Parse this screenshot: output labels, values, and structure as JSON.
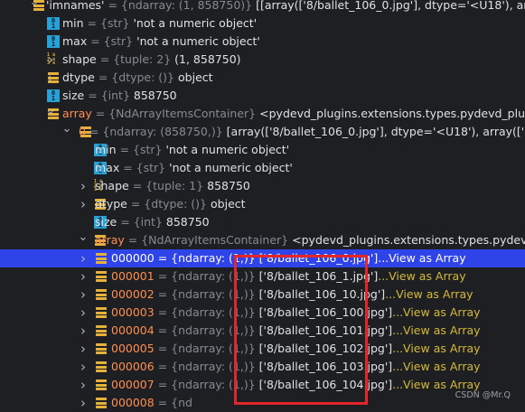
{
  "tree": {
    "rows": [
      {
        "level": 1,
        "arrow": "down",
        "icon": "bars",
        "name": "'imnames'",
        "name_color": "white",
        "type": "= {ndarray: (1, 858750)}",
        "value": "[[array(['8/ballet_106_0.jpg'], dtype='<U18'),  array(['8/bal",
        "value_style": "white",
        "selected": false
      },
      {
        "level": 2,
        "arrow": "none",
        "icon": "01",
        "name": "min",
        "name_color": "white",
        "type": "= {str}",
        "value": "'not a numeric object'",
        "value_style": "white",
        "selected": false
      },
      {
        "level": 2,
        "arrow": "none",
        "icon": "01",
        "name": "max",
        "name_color": "white",
        "type": "= {str}",
        "value": "'not a numeric object'",
        "value_style": "white",
        "selected": false
      },
      {
        "level": 2,
        "arrow": "right",
        "icon": "123",
        "name": "shape",
        "name_color": "white",
        "type": "= {tuple: 2}",
        "value": "(1, 858750)",
        "value_style": "white",
        "selected": false
      },
      {
        "level": 2,
        "arrow": "right",
        "icon": "bars",
        "name": "dtype",
        "name_color": "white",
        "type": "= {dtype: ()}",
        "value": "object",
        "value_style": "white",
        "selected": false
      },
      {
        "level": 2,
        "arrow": "none",
        "icon": "01",
        "name": "size",
        "name_color": "white",
        "type": "= {int}",
        "value": "858750",
        "value_style": "white",
        "selected": false
      },
      {
        "level": 2,
        "arrow": "down",
        "icon": "bars",
        "name": "array",
        "name_color": "orange",
        "type": "= {NdArrayItemsContainer}",
        "value": "<pydevd_plugins.extensions.types.pydevd_plugin_nump",
        "value_style": "white",
        "selected": false
      },
      {
        "level": 3,
        "arrow": "down",
        "icon": "bars",
        "name": "0",
        "name_color": "orange",
        "type": "= {ndarray: (858750,)}",
        "value": "[array(['8/ballet_106_0.jpg'], dtype='<U18'), array(['8/ballet_10",
        "value_style": "white",
        "selected": false
      },
      {
        "level": 4,
        "arrow": "none",
        "icon": "01",
        "name": "min",
        "name_color": "white",
        "type": "= {str}",
        "value": "'not a numeric object'",
        "value_style": "white",
        "selected": false
      },
      {
        "level": 4,
        "arrow": "none",
        "icon": "01",
        "name": "max",
        "name_color": "white",
        "type": "= {str}",
        "value": "'not a numeric object'",
        "value_style": "white",
        "selected": false
      },
      {
        "level": 4,
        "arrow": "right",
        "icon": "123",
        "name": "shape",
        "name_color": "white",
        "type": "= {tuple: 1}",
        "value": "858750",
        "value_style": "white",
        "selected": false
      },
      {
        "level": 4,
        "arrow": "right",
        "icon": "bars",
        "name": "dtype",
        "name_color": "white",
        "type": "= {dtype: ()}",
        "value": "object",
        "value_style": "white",
        "selected": false
      },
      {
        "level": 4,
        "arrow": "none",
        "icon": "01",
        "name": "size",
        "name_color": "white",
        "type": "= {int}",
        "value": "858750",
        "value_style": "white",
        "selected": false
      },
      {
        "level": 4,
        "arrow": "down",
        "icon": "bars",
        "name": "array",
        "name_color": "orange",
        "type": "= {NdArrayItemsContainer}",
        "value": "<pydevd_plugins.extensions.types.pydevd_plugin",
        "value_style": "white",
        "selected": false
      },
      {
        "level": 5,
        "arrow": "right",
        "icon": "bars",
        "name": "000000",
        "name_color": "orange",
        "type": "= {ndarray: (1,)}",
        "value": "['8/ballet_106_0.jpg']",
        "link": "...View as Array",
        "value_style": "white",
        "selected": true
      },
      {
        "level": 5,
        "arrow": "right",
        "icon": "bars",
        "name": "000001",
        "name_color": "orange",
        "type": "= {ndarray: (1,)}",
        "value": "['8/ballet_106_1.jpg']",
        "link": "...View as Array",
        "value_style": "white",
        "selected": false
      },
      {
        "level": 5,
        "arrow": "right",
        "icon": "bars",
        "name": "000002",
        "name_color": "orange",
        "type": "= {ndarray: (1,)}",
        "value": "['8/ballet_106_10.jpg']",
        "link": "...View as Array",
        "value_style": "white",
        "selected": false
      },
      {
        "level": 5,
        "arrow": "right",
        "icon": "bars",
        "name": "000003",
        "name_color": "orange",
        "type": "= {ndarray: (1,)}",
        "value": "['8/ballet_106_100.jpg']",
        "link": "...View as Array",
        "value_style": "white",
        "selected": false
      },
      {
        "level": 5,
        "arrow": "right",
        "icon": "bars",
        "name": "000004",
        "name_color": "orange",
        "type": "= {ndarray: (1,)}",
        "value": "['8/ballet_106_101.jpg']",
        "link": "...View as Array",
        "value_style": "white",
        "selected": false
      },
      {
        "level": 5,
        "arrow": "right",
        "icon": "bars",
        "name": "000005",
        "name_color": "orange",
        "type": "= {ndarray: (1,)}",
        "value": "['8/ballet_106_102.jpg']",
        "link": "...View as Array",
        "value_style": "white",
        "selected": false
      },
      {
        "level": 5,
        "arrow": "right",
        "icon": "bars",
        "name": "000006",
        "name_color": "orange",
        "type": "= {ndarray: (1,)}",
        "value": "['8/ballet_106_103.jpg']",
        "link": "...View as Array",
        "value_style": "white",
        "selected": false
      },
      {
        "level": 5,
        "arrow": "right",
        "icon": "bars",
        "name": "000007",
        "name_color": "orange",
        "type": "= {ndarray: (1,)}",
        "value": "['8/ballet_106_104.jpg']",
        "link": "...View as Array",
        "value_style": "white",
        "selected": false
      },
      {
        "level": 5,
        "arrow": "right",
        "icon": "bars",
        "name": "000008",
        "name_color": "orange",
        "type": "= {nd",
        "value": "",
        "value_style": "white",
        "selected": false
      }
    ]
  },
  "watermark": "CSDN @Mr.Q",
  "colors": {
    "background": "#1e1f22",
    "selection": "#2e43e8",
    "name_orange": "#ff8e52",
    "type_gray": "#868a91",
    "link_yellow": "#d4b93a",
    "highlight_box": "#e3262a"
  }
}
